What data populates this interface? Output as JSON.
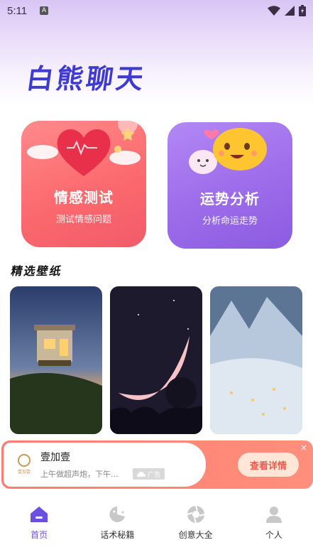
{
  "status_bar": {
    "time": "5:11",
    "indicator": "A",
    "icons": [
      "wifi-icon",
      "signal-icon",
      "battery-icon"
    ]
  },
  "app": {
    "title": "白熊聊天"
  },
  "cards": [
    {
      "title": "情感测试",
      "subtitle": "测试情感问题",
      "icon": "winged-heart-icon"
    },
    {
      "title": "运势分析",
      "subtitle": "分析命运走势",
      "icon": "emoji-bubbles-icon"
    }
  ],
  "section": {
    "wallpapers_title": "精选壁纸"
  },
  "wallpapers": [
    {
      "name": "house-at-dusk",
      "icon": "wallpaper-image"
    },
    {
      "name": "crescent-moon",
      "icon": "wallpaper-image"
    },
    {
      "name": "snowy-town",
      "icon": "wallpaper-image"
    }
  ],
  "ad": {
    "brand_logo_text": "壹加壹",
    "name": "壹加壹",
    "description": "上午做超声炮，下午...",
    "badge": "广告",
    "cta": "查看详情",
    "close": "×"
  },
  "tabbar": {
    "items": [
      {
        "label": "首页",
        "icon": "home-icon",
        "active": true
      },
      {
        "label": "话术秘籍",
        "icon": "pacman-chat-icon",
        "active": false
      },
      {
        "label": "创意大全",
        "icon": "aperture-icon",
        "active": false
      },
      {
        "label": "个人",
        "icon": "person-icon",
        "active": false
      }
    ]
  },
  "colors": {
    "accent": "#6a4fe0",
    "emotion_card": "#fb6a6e",
    "fortune_card": "#9c6cea",
    "ad_cta_text": "#ea5a4e"
  }
}
